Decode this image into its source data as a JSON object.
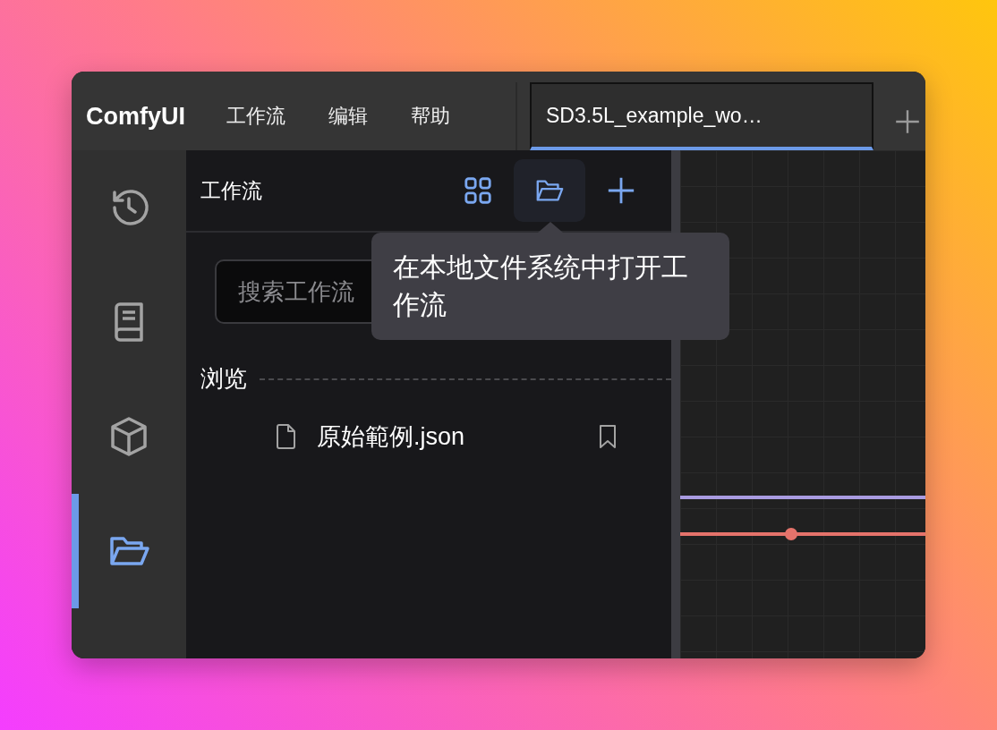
{
  "app": {
    "logo": "ComfyUI"
  },
  "menu": [
    {
      "label": "工作流"
    },
    {
      "label": "编辑"
    },
    {
      "label": "帮助"
    }
  ],
  "tabs": [
    {
      "label": "SD3.5L_example_wo…",
      "selected": true
    }
  ],
  "sidebar": {
    "items": [
      {
        "kind": "history",
        "selected": false
      },
      {
        "kind": "book",
        "selected": false
      },
      {
        "kind": "cube",
        "selected": false
      },
      {
        "kind": "folder",
        "selected": true
      }
    ]
  },
  "panel": {
    "title": "工作流",
    "toolbar": [
      {
        "kind": "grid",
        "hovered": false
      },
      {
        "kind": "folder",
        "hovered": true
      },
      {
        "kind": "plus",
        "hovered": false
      }
    ],
    "search": {
      "placeholder": "搜索工作流"
    },
    "section": "浏览",
    "files": [
      {
        "name": "原始範例.json"
      }
    ]
  },
  "tooltip": {
    "text": "在本地文件系统中打开工作流"
  },
  "canvas": {
    "links": [
      {
        "color": "#a99be0",
        "dot": false
      },
      {
        "color": "#e5736b",
        "dot": true
      }
    ]
  }
}
